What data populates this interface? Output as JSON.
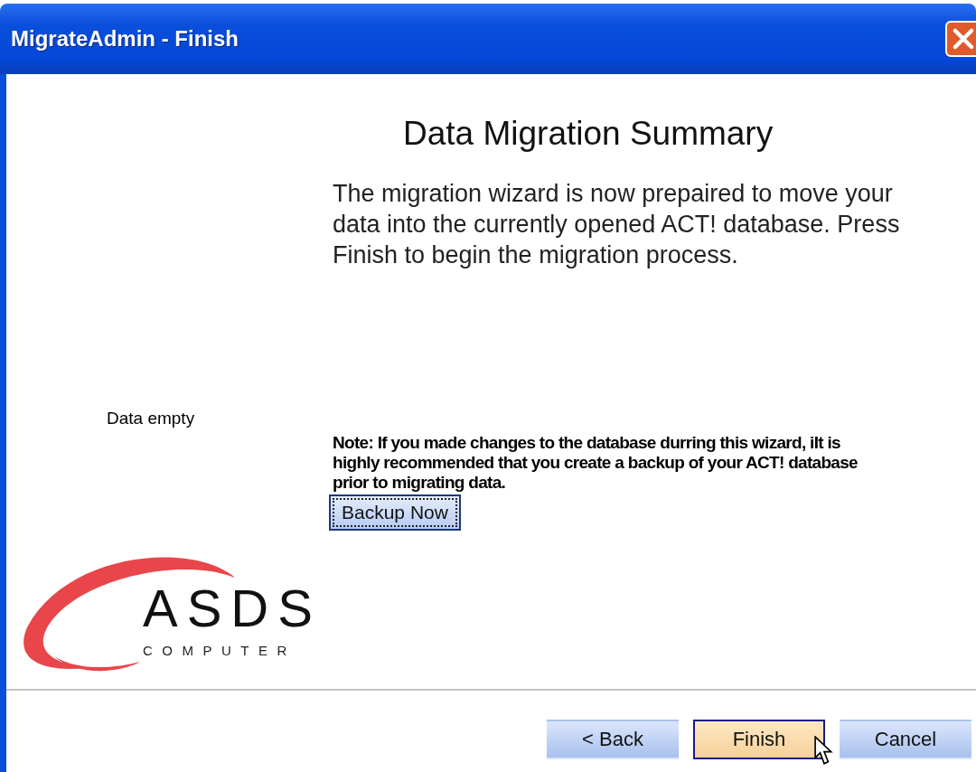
{
  "window": {
    "title": "MigrateAdmin - Finish"
  },
  "heading": "Data Migration Summary",
  "intro": "The migration wizard is now prepaired to move your data into the currently opened ACT! database. Press Finish to begin the migration process.",
  "status": "Data empty",
  "logo": {
    "name": "ASDS",
    "tagline": "COMPUTER"
  },
  "note": "Note: If you made changes to the database durring this wizard, iIt is highly recommended that you create a backup of your ACT! database prior to migrating data.",
  "backup_button": {
    "label": "Backup Now",
    "focused": true
  },
  "buttons": [
    {
      "label": "< Back",
      "highlighted": false
    },
    {
      "label": "Finish",
      "highlighted": true
    },
    {
      "label": "Cancel",
      "highlighted": false
    }
  ]
}
